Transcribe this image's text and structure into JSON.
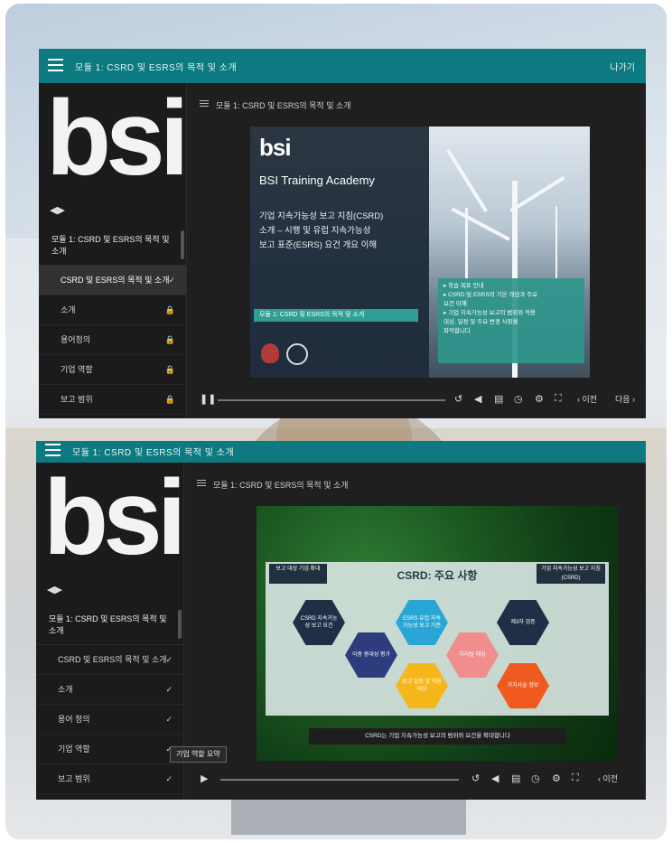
{
  "window1": {
    "header_title": "모듈 1: CSRD 및 ESRS의 목적 및 소개",
    "exit_label": "나가기",
    "sidebar_logo": "bsi",
    "sidebar_icon": "◀▶",
    "module_title": "모듈 1: CSRD 및 ESRS의 목적 및 소개",
    "items": [
      {
        "label": "CSRD 및 ESRS의 목적 및 소개",
        "status": "✓"
      },
      {
        "label": "소개",
        "status": "🔒"
      },
      {
        "label": "용어정의",
        "status": "🔒"
      },
      {
        "label": "기업 역할",
        "status": "🔒"
      },
      {
        "label": "보고 범위",
        "status": "🔒"
      }
    ],
    "lesson_heading": "모듈 1: CSRD 및 ESRS의 목적 및 소개",
    "slide": {
      "logo": "bsi",
      "academy": "BSI Training Academy",
      "title_lines": [
        "기업 지속가능성 보고 지침(CSRD)",
        "소개 – 시행 및 유럽 지속가능성",
        "보고 표준(ESRS) 요건 개요 이해"
      ],
      "tag": "모듈 1: CSRD 및 ESRS의 목적 및 소개",
      "note_lines": [
        "▸ 학습 목표 안내",
        "▸ CSRD 및 ESRS의 기본 개념과 주요",
        "  요건 이해",
        "▸ 기업 지속가능성 보고의 범위와 적용",
        "  대상, 일정 및 주요 변경 사항을",
        "  파악합니다"
      ]
    },
    "controls": {
      "play": "❚❚",
      "replay": "↺",
      "volume": "◀",
      "captions": "▤",
      "speed": "◷",
      "settings": "⚙",
      "fullscreen": "⛶",
      "prev": "‹ 이전",
      "next": "다음 ›"
    }
  },
  "window2": {
    "header_title": "모듈 1: CSRD 및 ESRS의 목적 및 소개",
    "sidebar_logo": "bsi",
    "sidebar_icon": "◀▶",
    "module_title": "모듈 1: CSRD 및 ESRS의 목적 및 소개",
    "items": [
      {
        "label": "CSRD 및 ESRS의 목적 및 소개",
        "status": "✓"
      },
      {
        "label": "소개",
        "status": "✓"
      },
      {
        "label": "용어 정의",
        "status": "✓"
      },
      {
        "label": "기업 역할",
        "status": "✓"
      },
      {
        "label": "보고 범위",
        "status": "✓"
      }
    ],
    "tooltip": "기업 역할 요약",
    "lesson_heading": "모듈 1: CSRD 및 ESRS의 목적 및 소개",
    "slide": {
      "title": "CSRD: 주요 사항",
      "box_left": "보고 대상 기업 확대",
      "box_right": "기업 지속가능성 보고 지침(CSRD)",
      "hexes": [
        "CSRD 지속가능성 보고 요건",
        "이중 중대성 평가",
        "ESRS 유럽 지속가능성 보고 기준",
        "디지털 태깅",
        "제3자 검증",
        "보고 일정 및 적용 대상",
        "가치사슬 정보"
      ],
      "caption": "CSRD는 기업 지속가능성 보고의 범위와 요건을 확대합니다"
    },
    "controls": {
      "play": "▶",
      "replay": "↺",
      "volume": "◀",
      "captions": "▤",
      "speed": "◷",
      "settings": "⚙",
      "fullscreen": "⛶",
      "prev": "‹ 이전"
    }
  }
}
